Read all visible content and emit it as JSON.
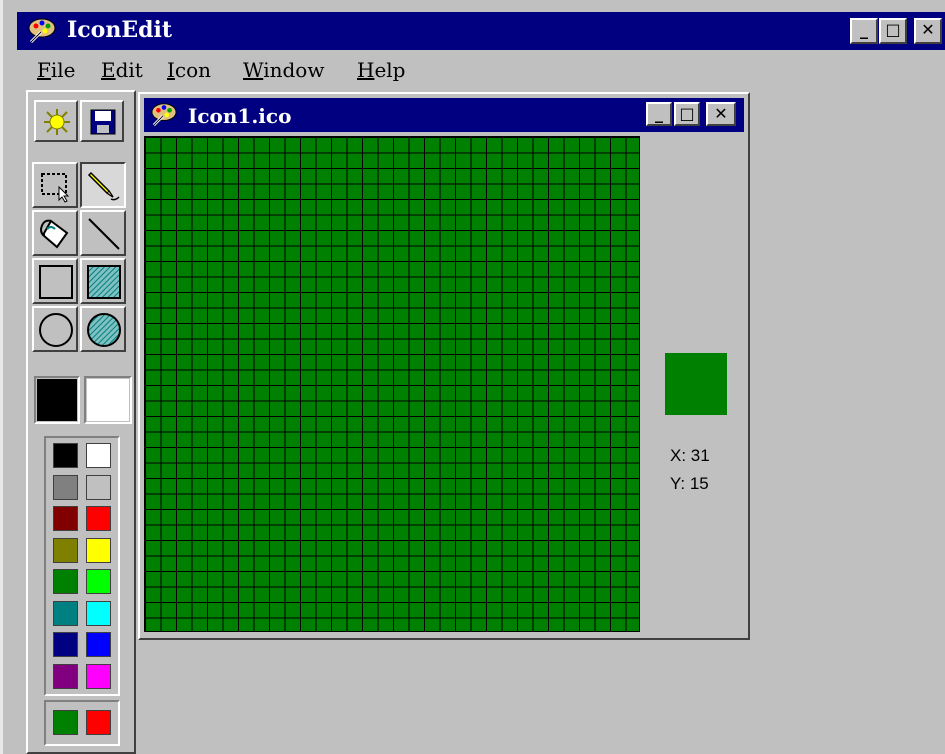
{
  "app": {
    "title": "IconEdit",
    "window_buttons": {
      "minimize": "_",
      "maximize": "□",
      "close": "✕"
    }
  },
  "menu": [
    {
      "underline": "F",
      "rest": "ile"
    },
    {
      "underline": "E",
      "rest": "dit"
    },
    {
      "underline": "I",
      "rest": "con"
    },
    {
      "underline": "W",
      "rest": "indow"
    },
    {
      "underline": "H",
      "rest": "elp"
    }
  ],
  "toolbox": {
    "tools": [
      "new-icon",
      "save-icon",
      "select-icon",
      "pencil-icon",
      "fill-icon",
      "line-icon",
      "rectangle-icon",
      "filled-rectangle-icon",
      "ellipse-icon",
      "filled-ellipse-icon"
    ],
    "active_tool": "pencil",
    "primary_color": "#000000",
    "secondary_color": "#ffffff",
    "palette": [
      [
        "#000000",
        "#ffffff"
      ],
      [
        "#808080",
        "#c0c0c0"
      ],
      [
        "#800000",
        "#ff0000"
      ],
      [
        "#808000",
        "#ffff00"
      ],
      [
        "#008000",
        "#00ff00"
      ],
      [
        "#008080",
        "#00ffff"
      ],
      [
        "#000080",
        "#0000ff"
      ],
      [
        "#800080",
        "#ff00ff"
      ]
    ],
    "current_pair": [
      "#008000",
      "#ff0000"
    ]
  },
  "document": {
    "title": "Icon1.ico",
    "grid_cells": 32,
    "fill_color": "#008000",
    "preview_color": "#008000",
    "coord_x": "X: 31",
    "coord_y": "Y: 15"
  }
}
